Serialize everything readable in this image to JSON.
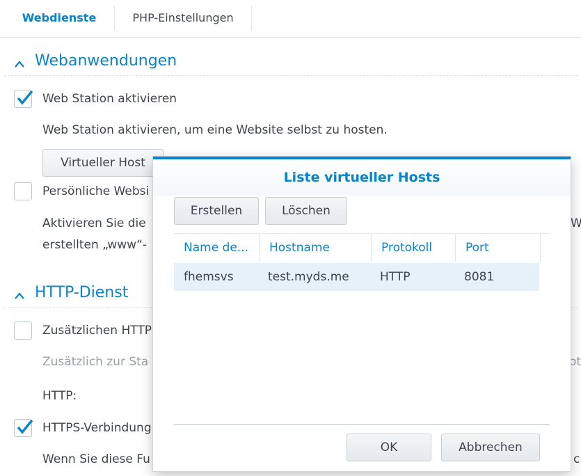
{
  "tabs": [
    {
      "label": "Webdienste",
      "active": true
    },
    {
      "label": "PHP-Einstellungen",
      "active": false
    }
  ],
  "colors": {
    "accent": "#0a84c9",
    "selected_row": "#e7f1fa"
  },
  "sections": {
    "webapps": {
      "title": "Webanwendungen",
      "icon": "chevron-up-icon",
      "enable_webstation": {
        "label": "Web Station aktivieren",
        "checked": true
      },
      "description": "Web Station aktivieren, um eine Website selbst zu hosten.",
      "virtual_host_button": "Virtueller Host",
      "personal_website": {
        "label": "Persönliche Websi",
        "checked": false
      },
      "personal_desc_line1": "Aktivieren Sie die",
      "personal_desc_line1_tail": "W",
      "personal_desc_line2": "erstellten „www“-"
    },
    "http": {
      "title": "HTTP-Dienst",
      "icon": "chevron-up-icon",
      "additional_http": {
        "label": "Zusätzlichen HTTP",
        "checked": false
      },
      "additional_desc": "Zusätzlich zur Sta",
      "additional_desc_tail": "ot",
      "http_label": "HTTP:",
      "https": {
        "label": "HTTPS-Verbindung",
        "checked": true
      },
      "https_desc": "Wenn Sie diese Fu",
      "https_desc_tail": "c"
    }
  },
  "dialog": {
    "title": "Liste virtueller Hosts",
    "toolbar": {
      "create": "Erstellen",
      "delete": "Löschen"
    },
    "columns": [
      "Name de...",
      "Hostname",
      "Protokoll",
      "Port"
    ],
    "rows": [
      {
        "name": "fhemsvs",
        "hostname": "test.myds.me",
        "protocol": "HTTP",
        "port": "8081",
        "selected": true
      }
    ],
    "footer": {
      "ok": "OK",
      "cancel": "Abbrechen"
    }
  }
}
